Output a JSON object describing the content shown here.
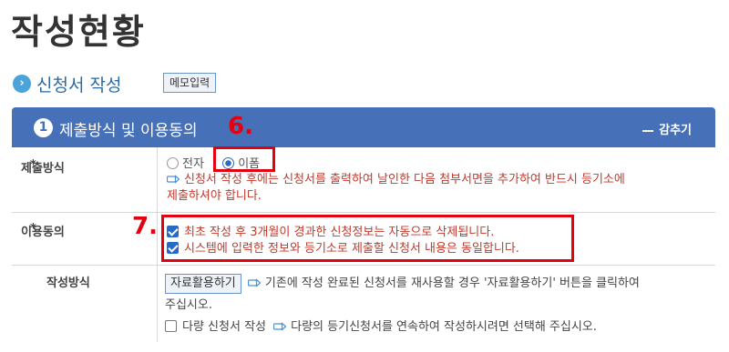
{
  "page": {
    "title": "작성현황"
  },
  "section": {
    "title": "신청서 작성",
    "memo_button": "메모입력"
  },
  "panel": {
    "step_number": "1",
    "title": "제출방식 및 이용동의",
    "collapse_label": "감추기"
  },
  "annotations": {
    "six": "6.",
    "seven": "7."
  },
  "submission": {
    "label": "제출방식",
    "options": [
      {
        "label": "전자",
        "selected": false
      },
      {
        "label": "이폼",
        "selected": true
      }
    ],
    "notice": [
      "신청서 작성 후에는 신청서를 출력하여 날인한 다음 첨부서면을 추가하여 반드시 등기소에",
      "제출하셔야 합니다."
    ]
  },
  "consent": {
    "label": "이용동의",
    "items": [
      {
        "text": "최초 작성 후 3개월이 경과한 신청정보는 자동으로 삭제됩니다.",
        "checked": true
      },
      {
        "text": "시스템에 입력한 정보와 등기소로 제출할 신청서 내용은 동일합니다.",
        "checked": true
      }
    ]
  },
  "method": {
    "label": "작성방식",
    "reuse_button": "자료활용하기",
    "reuse_text_line1": "기존에 작성 완료된 신청서를 재사용할 경우 '자료활용하기' 버튼을 클릭하여",
    "reuse_text_line2": "주십시오.",
    "multi_label": "다량 신청서 작성",
    "multi_checked": false,
    "multi_text": "다량의 등기신청서를 연속하여 작성하시려면 선택해 주십시오."
  },
  "colors": {
    "panel_bar": "#4670b8",
    "accent_blue": "#2a6ac7",
    "notice_red": "#c0392b",
    "annotation_red": "#e3000f"
  }
}
